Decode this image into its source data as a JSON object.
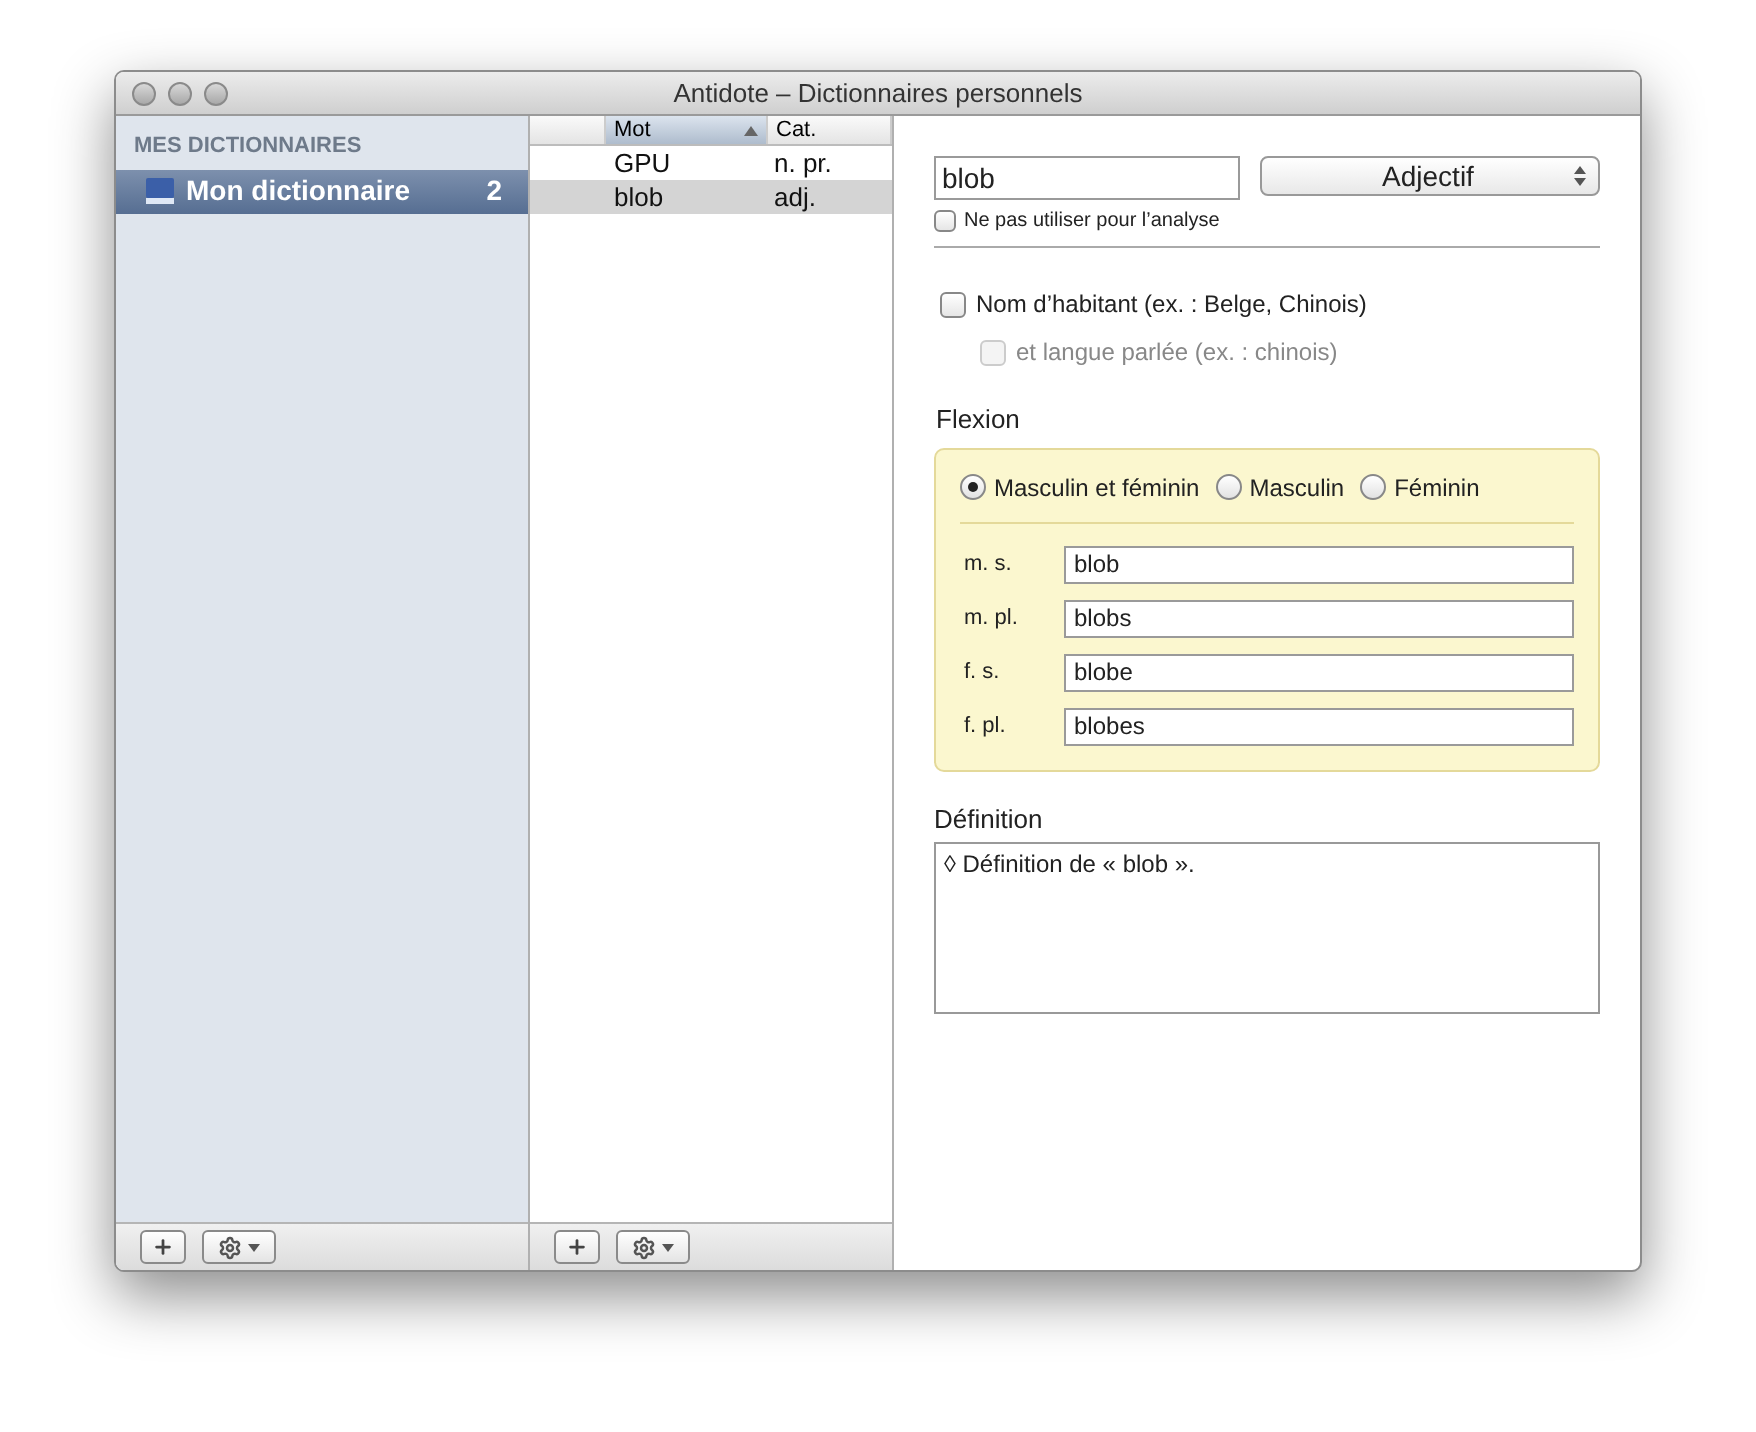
{
  "window": {
    "title": "Antidote – Dictionnaires personnels"
  },
  "sidebar": {
    "heading": "MES DICTIONNAIRES",
    "items": [
      {
        "label": "Mon dictionnaire",
        "count": "2",
        "selected": true
      }
    ]
  },
  "word_list": {
    "columns": [
      {
        "label": "Mot",
        "sorted": true
      },
      {
        "label": "Cat.",
        "sorted": false
      }
    ],
    "rows": [
      {
        "word": "GPU",
        "category": "n. pr.",
        "selected": false
      },
      {
        "word": "blob",
        "category": "adj.",
        "selected": true
      }
    ]
  },
  "editor": {
    "word": "blob",
    "category": "Adjectif",
    "exclude": {
      "label": "Ne pas utiliser pour l’analyse",
      "checked": false
    },
    "inhabitant": {
      "label": "Nom d’habitant (ex. : Belge, Chinois)",
      "checked": false
    },
    "language": {
      "label": "et langue parlée (ex. : chinois)",
      "checked": false,
      "disabled": true
    },
    "flexion": {
      "title": "Flexion",
      "genders": [
        {
          "label": "Masculin et féminin",
          "selected": true
        },
        {
          "label": "Masculin",
          "selected": false
        },
        {
          "label": "Féminin",
          "selected": false
        }
      ],
      "forms": [
        {
          "label": "m. s.",
          "value": "blob"
        },
        {
          "label": "m. pl.",
          "value": "blobs"
        },
        {
          "label": "f. s.",
          "value": "blobe"
        },
        {
          "label": "f. pl.",
          "value": "blobes"
        }
      ]
    },
    "definition": {
      "title": "Définition",
      "value": "◊ Définition de « blob »."
    }
  }
}
